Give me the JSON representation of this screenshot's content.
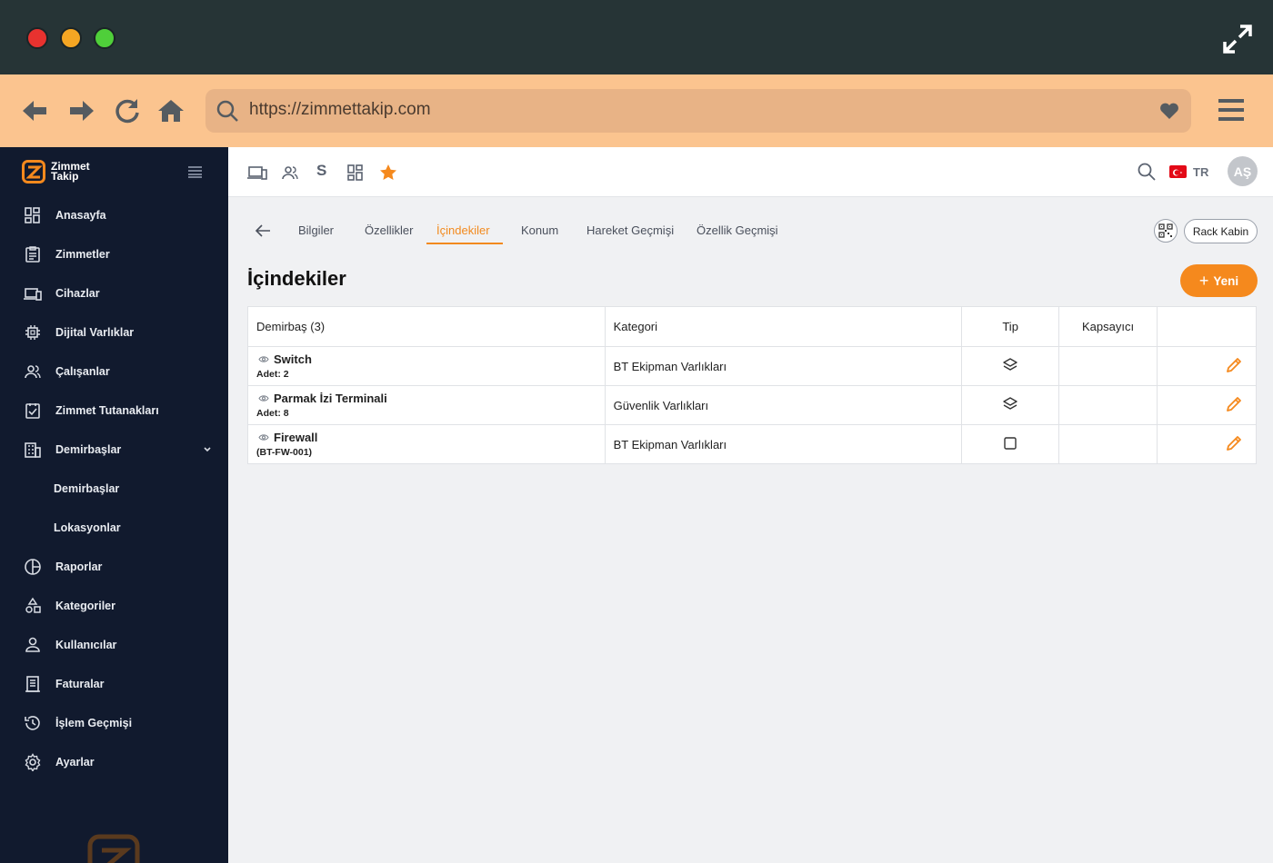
{
  "browser": {
    "url": "https://zimmettakip.com"
  },
  "sidebar": {
    "brand_line1": "Zimmet",
    "brand_line2": "Takip",
    "items": [
      {
        "label": "Anasayfa",
        "icon": "dashboard-icon"
      },
      {
        "label": "Zimmetler",
        "icon": "clipboard-icon"
      },
      {
        "label": "Cihazlar",
        "icon": "devices-icon"
      },
      {
        "label": "Dijital Varlıklar",
        "icon": "chip-icon"
      },
      {
        "label": "Çalışanlar",
        "icon": "people-icon"
      },
      {
        "label": "Zimmet Tutanakları",
        "icon": "checklist-icon"
      },
      {
        "label": "Demirbaşlar",
        "icon": "building-icon"
      },
      {
        "label": "Demirbaşlar"
      },
      {
        "label": "Lokasyonlar"
      },
      {
        "label": "Raporlar",
        "icon": "pie-icon"
      },
      {
        "label": "Kategoriler",
        "icon": "shapes-icon"
      },
      {
        "label": "Kullanıcılar",
        "icon": "user-icon"
      },
      {
        "label": "Faturalar",
        "icon": "invoice-icon"
      },
      {
        "label": "İşlem Geçmişi",
        "icon": "history-icon"
      },
      {
        "label": "Ayarlar",
        "icon": "gear-icon"
      }
    ]
  },
  "topbar": {
    "s_label": "S",
    "lang": "TR",
    "avatar_initials": "AŞ"
  },
  "tabs": [
    "Bilgiler",
    "Özellikler",
    "İçindekiler",
    "Konum",
    "Hareket Geçmişi",
    "Özellik Geçmişi"
  ],
  "active_tab": "İçindekiler",
  "rack_button": "Rack Kabin",
  "page_title": "İçindekiler",
  "new_button": "Yeni",
  "table": {
    "headers": [
      "Demirbaş (3)",
      "Kategori",
      "Tip",
      "Kapsayıcı",
      ""
    ],
    "rows": [
      {
        "name": "Switch",
        "sub": "Adet: 2",
        "category": "BT Ekipman Varlıkları",
        "type_icon": "layers-icon",
        "container": ""
      },
      {
        "name": "Parmak İzi Terminali",
        "sub": "Adet: 8",
        "category": "Güvenlik Varlıkları",
        "type_icon": "layers-icon",
        "container": ""
      },
      {
        "name": "Firewall",
        "sub": "(BT-FW-001)",
        "category": "BT Ekipman Varlıkları",
        "type_icon": "square-icon",
        "container": ""
      }
    ]
  },
  "colors": {
    "accent": "#f5891d",
    "sidebar_bg": "#111a2e",
    "chrome_bar": "#fbc48f"
  }
}
